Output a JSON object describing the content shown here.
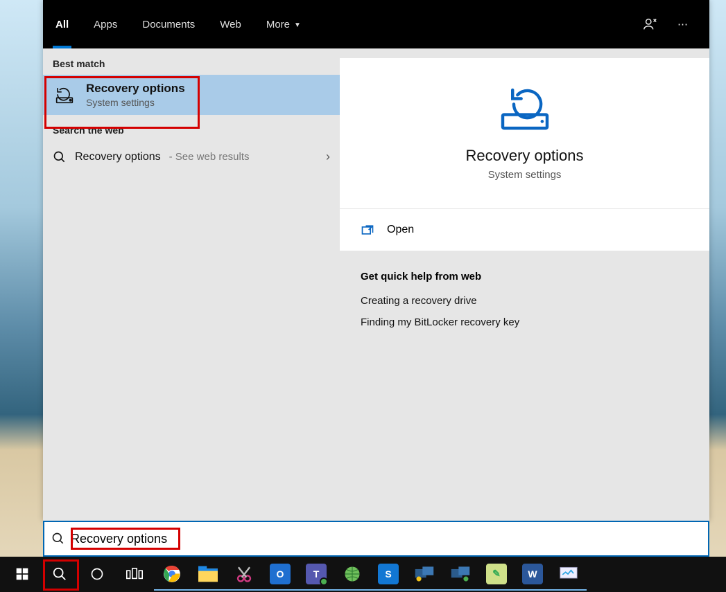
{
  "tabs": {
    "all": "All",
    "apps": "Apps",
    "documents": "Documents",
    "web": "Web",
    "more": "More"
  },
  "left": {
    "best_match_label": "Best match",
    "best_match": {
      "title": "Recovery options",
      "subtitle": "System settings"
    },
    "search_web_label": "Search the web",
    "web_item": {
      "title": "Recovery options",
      "suffix": " - See web results"
    }
  },
  "right": {
    "hero_title": "Recovery options",
    "hero_subtitle": "System settings",
    "open_label": "Open",
    "help_heading": "Get quick help from web",
    "help_links": [
      "Creating a recovery drive",
      "Finding my BitLocker recovery key"
    ]
  },
  "search": {
    "value": "Recovery options"
  },
  "taskbar": {
    "apps": [
      {
        "name": "chrome",
        "bg": "#fff"
      },
      {
        "name": "explorer",
        "bg": "#ffcf3f"
      },
      {
        "name": "snip",
        "bg": "#d94a8f"
      },
      {
        "name": "outlook",
        "bg": "#1f6fd0"
      },
      {
        "name": "teams",
        "bg": "#5558af"
      },
      {
        "name": "globe",
        "bg": "#56a24a"
      },
      {
        "name": "shield",
        "bg": "#1277d3"
      },
      {
        "name": "remote1",
        "bg": "#1b365f"
      },
      {
        "name": "remote2",
        "bg": "#1b365f"
      },
      {
        "name": "notes",
        "bg": "#cfe089"
      },
      {
        "name": "word",
        "bg": "#2b579a"
      },
      {
        "name": "monitor",
        "bg": "#eef"
      }
    ]
  }
}
